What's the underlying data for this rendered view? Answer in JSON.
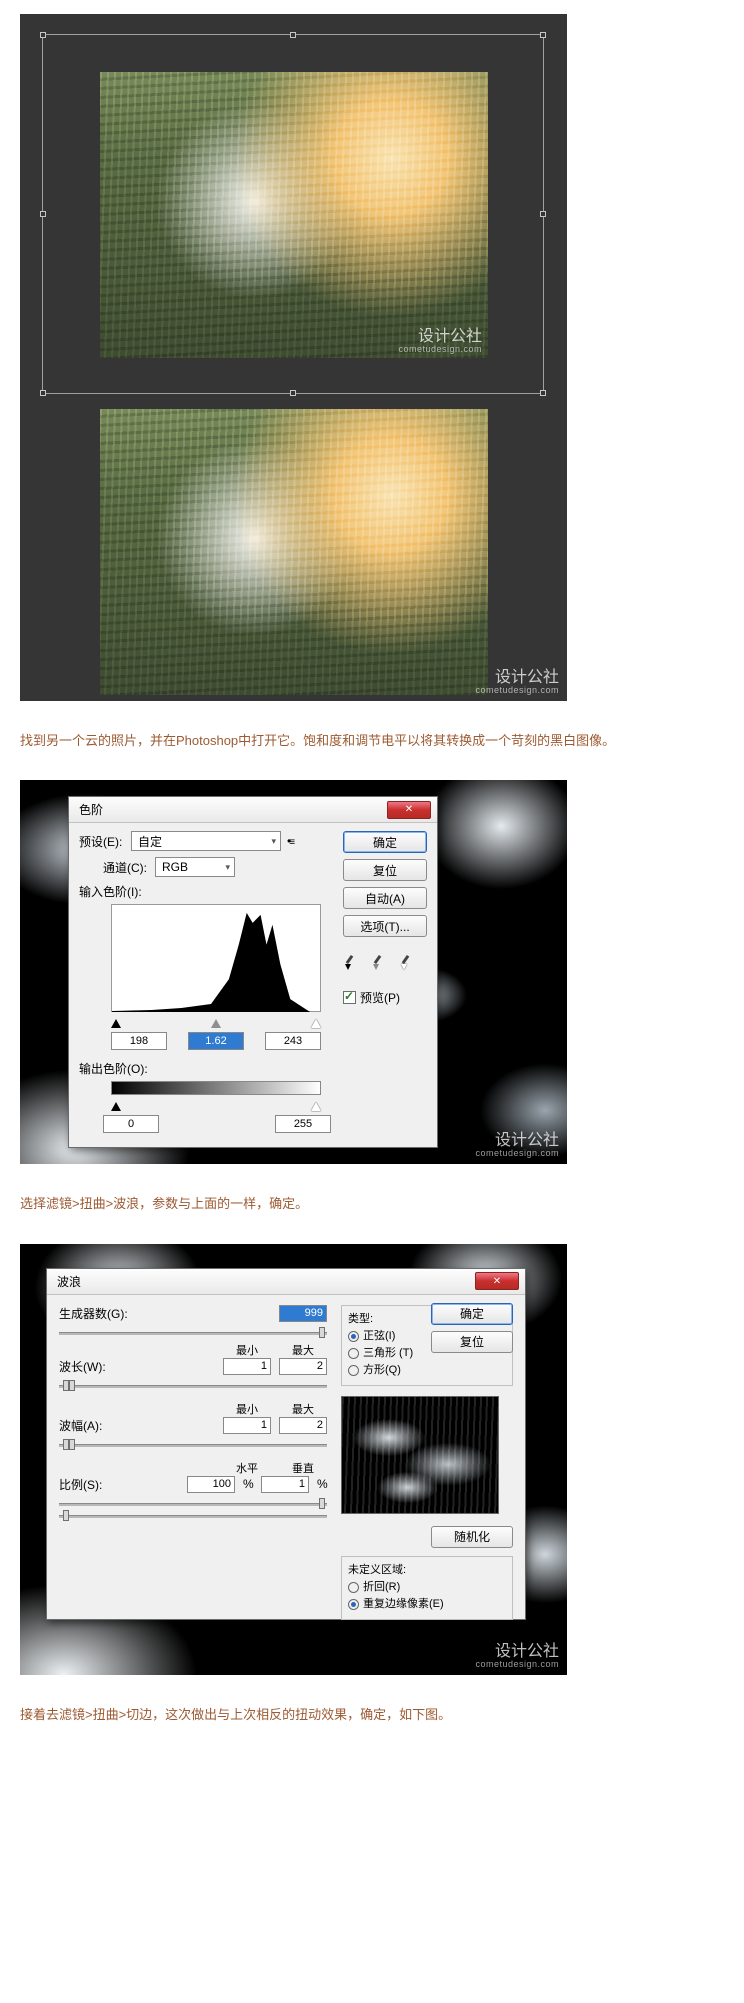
{
  "watermark": {
    "main": "设计公社",
    "sub": "cometudesign.com"
  },
  "caption1": "找到另一个云的照片，并在Photoshop中打开它。饱和度和调节电平以将其转换成一个苛刻的黑白图像。",
  "caption2": "选择滤镜>扭曲>波浪，参数与上面的一样，确定。",
  "caption3": "接着去滤镜>扭曲>切边，这次做出与上次相反的扭动效果，确定，如下图。",
  "levels": {
    "title": "色阶",
    "preset_label": "预设(E):",
    "preset_value": "自定",
    "channel_label": "通道(C):",
    "channel_value": "RGB",
    "input_label": "输入色阶(I):",
    "in_black": "198",
    "in_gamma": "1.62",
    "in_white": "243",
    "output_label": "输出色阶(O):",
    "out_black": "0",
    "out_white": "255",
    "ok": "确定",
    "cancel": "复位",
    "auto": "自动(A)",
    "options": "选项(T)...",
    "preview": "预览(P)"
  },
  "wave": {
    "title": "波浪",
    "generators_label": "生成器数(G):",
    "generators_value": "999",
    "min_header": "最小",
    "max_header": "最大",
    "wavelength_label": "波长(W):",
    "wavelength_min": "1",
    "wavelength_max": "2",
    "amplitude_label": "波幅(A):",
    "amplitude_min": "1",
    "amplitude_max": "2",
    "scale_label": "比例(S):",
    "horiz_header": "水平",
    "vert_header": "垂直",
    "scale_h": "100",
    "scale_v": "1",
    "percent": "%",
    "type_title": "类型:",
    "type_sine": "正弦(I)",
    "type_tri": "三角形 (T)",
    "type_square": "方形(Q)",
    "ok": "确定",
    "cancel": "复位",
    "randomize": "随机化",
    "undefined_title": "未定义区域:",
    "undef_wrap": "折回(R)",
    "undef_repeat": "重复边缘像素(E)"
  }
}
